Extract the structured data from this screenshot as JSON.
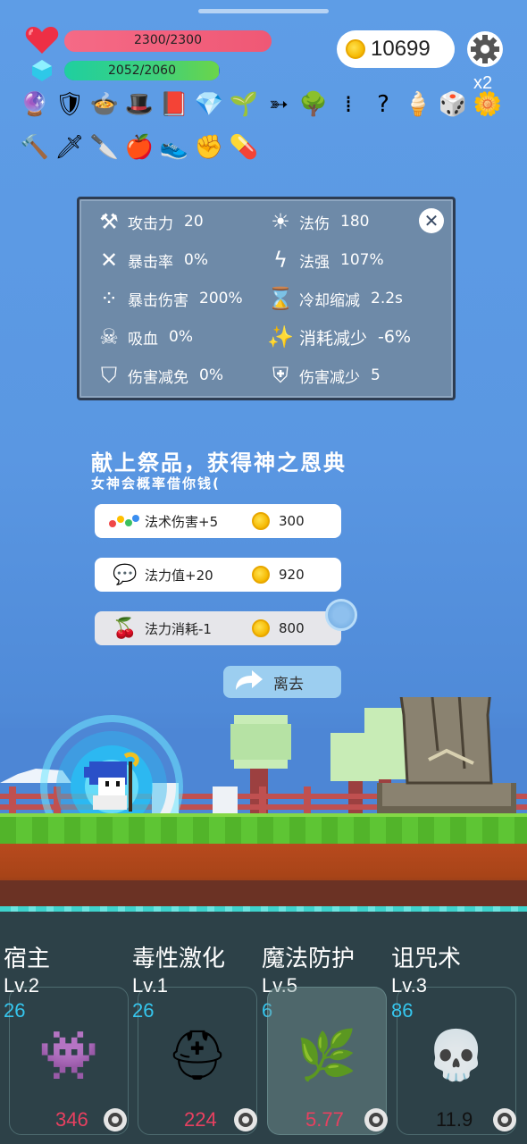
{
  "hud": {
    "hp": {
      "text": "2300/2300",
      "fraction": 1.0,
      "color": "#f05a78"
    },
    "mp": {
      "text": "2052/2060",
      "fraction": 0.996,
      "color": "#3fd07a"
    },
    "coins": "10699",
    "multiplier": "x2"
  },
  "inventory": {
    "row1": [
      "crystal-ball-icon",
      "shield-icon",
      "cauldron-icon",
      "witch-hat-icon",
      "skull-book-icon",
      "diamond-icon",
      "sapling-icon",
      "arrows-icon",
      "tree-icon",
      "bullets-icon",
      "cane-icon",
      "ice-cream-icon",
      "dice-icon",
      "flower-icon"
    ],
    "row2": [
      "hammer-icon",
      "sword-icon",
      "dagger-icon",
      "apple-icon",
      "sneaker-icon",
      "fist-icon",
      "pill-icon"
    ]
  },
  "stats": {
    "left": [
      {
        "icon": "axe-icon",
        "label": "攻击力",
        "value": "20"
      },
      {
        "icon": "crit-icon",
        "label": "暴击率",
        "value": "0%"
      },
      {
        "icon": "ring-icon",
        "label": "暴击伤害",
        "value": "200%"
      },
      {
        "icon": "vampire-skull-icon",
        "label": "吸血",
        "value": "0%"
      },
      {
        "icon": "shield-icon",
        "label": "伤害减免",
        "value": "0%"
      }
    ],
    "right": [
      {
        "icon": "sun-icon",
        "label": "法伤",
        "value": "180"
      },
      {
        "icon": "lightning-icon",
        "label": "法强",
        "value": "107%"
      },
      {
        "icon": "hourglass-icon",
        "label": "冷却缩减",
        "value": "2.2s"
      },
      {
        "icon": "magic-wand-icon",
        "label": "消耗减少",
        "value": "-6%"
      },
      {
        "icon": "heart-shield-icon",
        "label": "伤害减少",
        "value": "5"
      }
    ]
  },
  "offering": {
    "title": "献上祭品，获得神之恩典",
    "subtitle": "女神会概率借你钱(",
    "options": [
      {
        "name": "法术伤害+5",
        "cost": "300"
      },
      {
        "name": "法力值+20",
        "cost": "920"
      },
      {
        "name": "法力消耗-1",
        "cost": "800"
      }
    ],
    "leave": "离去"
  },
  "skills": [
    {
      "name": "宿主",
      "level": "Lv.2",
      "count": "26",
      "cost": "346"
    },
    {
      "name": "毒性激化",
      "level": "Lv.1",
      "count": "26",
      "cost": "224"
    },
    {
      "name": "魔法防护",
      "level": "Lv.5",
      "count": "6",
      "cost": "5.77"
    },
    {
      "name": "诅咒术",
      "level": "Lv.3",
      "count": "86",
      "cost": "11.9"
    }
  ]
}
